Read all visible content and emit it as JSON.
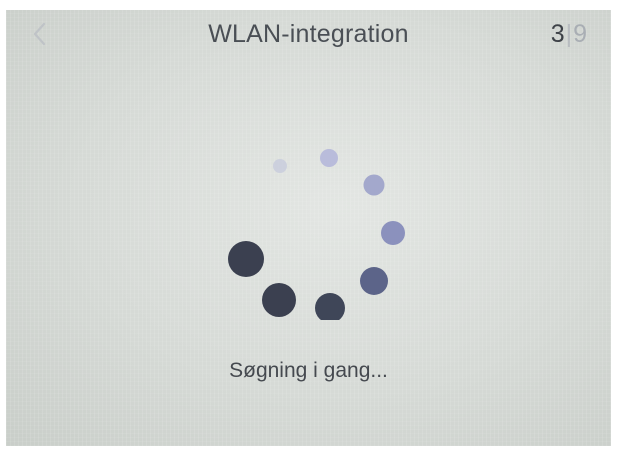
{
  "header": {
    "back_icon": "chevron-left-icon",
    "title": "WLAN-integration",
    "step": {
      "current": "3",
      "separator": "|",
      "total": "9"
    }
  },
  "main": {
    "loading_indicator": "spinner-dots",
    "status_text": "Søgning i gang..."
  },
  "colors": {
    "text": "#4a4f55",
    "spinner_dark": "#3b4050",
    "spinner_light": "#9aa0c4"
  }
}
